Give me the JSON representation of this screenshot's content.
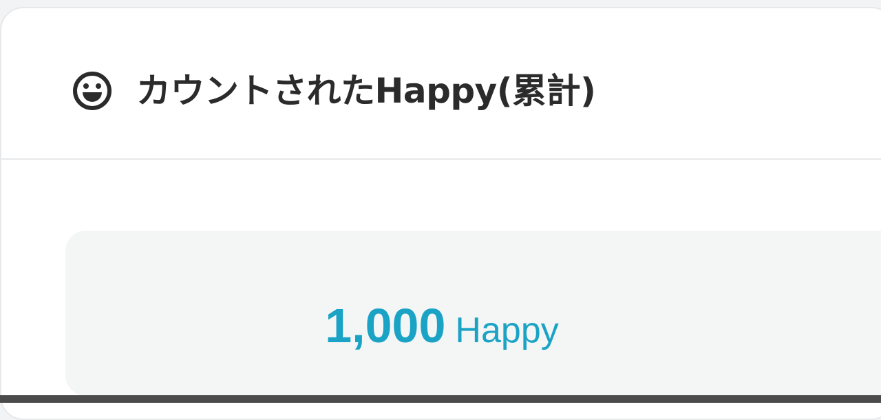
{
  "header": {
    "icon": "smile-icon",
    "title": "カウントされたHappy(累計)"
  },
  "stat": {
    "value": "1,000",
    "unit": "Happy"
  },
  "colors": {
    "accent": "#1ba3c6",
    "title_text": "#2b2b2b",
    "stat_background": "#f4f6f6",
    "border": "#e6e8ea"
  }
}
